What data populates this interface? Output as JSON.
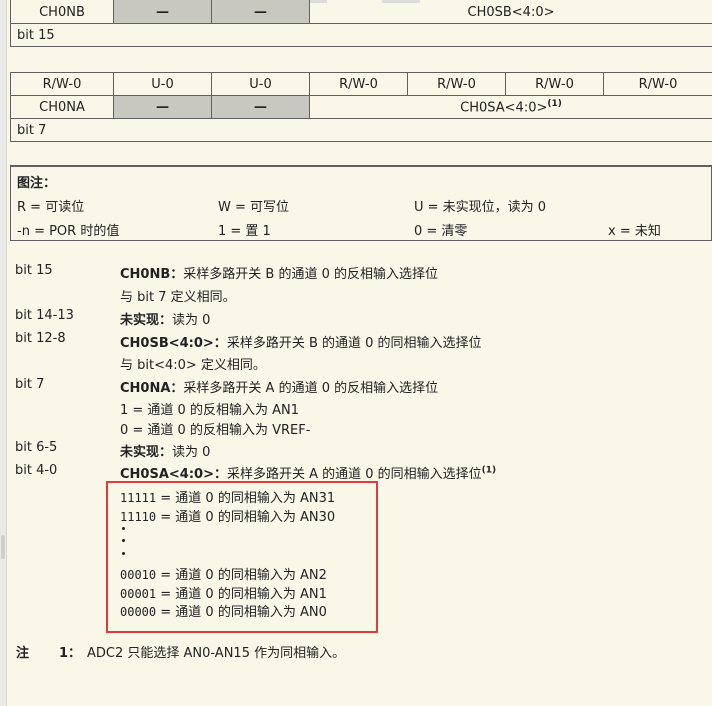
{
  "high_register": {
    "cells": [
      "CH0NB",
      "—",
      "—",
      "CH0SB<4:0>"
    ],
    "bit_label": "bit 15"
  },
  "low_register": {
    "access": [
      "R/W-0",
      "U-0",
      "U-0",
      "R/W-0",
      "R/W-0",
      "R/W-0",
      "R/W-0"
    ],
    "cells": [
      "CH0NA",
      "—",
      "—",
      "CH0SA<4:0>"
    ],
    "ch0sa_note": "(1)",
    "bit_label": "bit 7"
  },
  "legend": {
    "title": "图注：",
    "row1": [
      "R = 可读位",
      "W = 可写位",
      "U = 未实现位，读为 0"
    ],
    "row2": [
      "-n = POR 时的值",
      "1 = 置 1",
      "0 = 清零",
      "x = 未知"
    ]
  },
  "bits": [
    {
      "bit": "bit 15",
      "name": "CH0NB：",
      "title": "采样多路开关 B 的通道 0 的反相输入选择位",
      "lines": [
        "与 bit 7 定义相同。"
      ]
    },
    {
      "bit": "bit 14-13",
      "name": "未实现：",
      "title": "读为 0",
      "lines": []
    },
    {
      "bit": "bit 12-8",
      "name": "CH0SB<4:0>：",
      "title": "采样多路开关 B 的通道 0 的同相输入选择位",
      "lines": [
        "与 bit<4:0> 定义相同。"
      ]
    },
    {
      "bit": "bit 7",
      "name": "CH0NA：",
      "title": "采样多路开关 A 的通道 0 的反相输入选择位",
      "lines": [
        "1 = 通道 0 的反相输入为 AN1",
        "0 = 通道 0 的反相输入为 VREF-"
      ]
    },
    {
      "bit": "bit 6-5",
      "name": "未实现：",
      "title": "读为 0",
      "lines": []
    },
    {
      "bit": "bit 4-0",
      "name": "CH0SA<4:0>：",
      "title": "采样多路开关 A 的通道 0 的同相输入选择位",
      "note": "(1)",
      "lines": []
    }
  ],
  "ch0sa_options": [
    {
      "code": "11111",
      "text": " = 通道 0 的同相输入为 AN31"
    },
    {
      "code": "11110",
      "text": " = 通道 0 的同相输入为 AN30"
    },
    {
      "code": "00010",
      "text": " = 通道 0 的同相输入为 AN2"
    },
    {
      "code": "00001",
      "text": " = 通道 0 的同相输入为 AN1"
    },
    {
      "code": "00000",
      "text": " = 通道 0 的同相输入为 AN0"
    }
  ],
  "footnote": {
    "label": "注",
    "number": "1：",
    "text": "ADC2 只能选择 AN0-AN15 作为同相输入。"
  },
  "colors": {
    "page_bg": "#f8f7e8",
    "gray_cell": "#c8c8c0",
    "highlight_box": "#e03a3a"
  }
}
